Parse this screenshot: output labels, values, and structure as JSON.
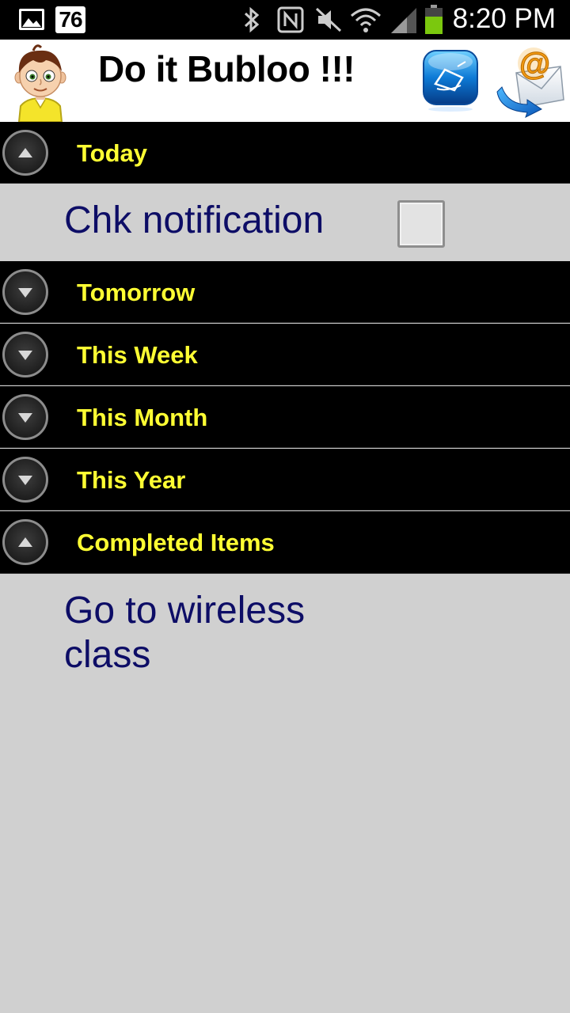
{
  "status_bar": {
    "notification_count": "76",
    "time": "8:20 PM",
    "icons": [
      "gallery-icon",
      "bluetooth-icon",
      "nfc-icon",
      "mute-icon",
      "wifi-icon",
      "signal-icon",
      "battery-icon"
    ]
  },
  "header": {
    "title": "Do it Bubloo !!!",
    "avatar_icon": "boy-avatar-icon",
    "buttons": [
      {
        "name": "notepad-button",
        "icon": "notepad-icon"
      },
      {
        "name": "email-button",
        "icon": "email-icon"
      }
    ]
  },
  "groups": [
    {
      "label": "Today",
      "expanded": true
    },
    {
      "label": "Tomorrow",
      "expanded": false
    },
    {
      "label": "This Week",
      "expanded": false
    },
    {
      "label": "This Month",
      "expanded": false
    },
    {
      "label": "This Year",
      "expanded": false
    },
    {
      "label": "Completed Items",
      "expanded": true
    }
  ],
  "today_items": [
    {
      "text": "Chk notification",
      "checked": false
    }
  ],
  "completed_items": [
    {
      "text": "Go to wireless class"
    }
  ],
  "colors": {
    "group_label": "#ffff33",
    "item_text": "#0d0d66",
    "list_background": "#d0d0d0"
  }
}
